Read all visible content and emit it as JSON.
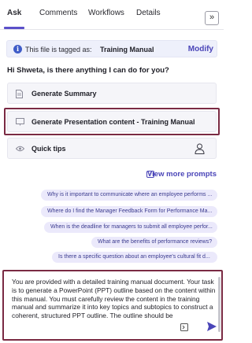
{
  "tabs": [
    {
      "label": "Ask",
      "active": true
    },
    {
      "label": "Comments",
      "active": false
    },
    {
      "label": "Workflows",
      "active": false
    },
    {
      "label": "Details",
      "active": false
    }
  ],
  "collapse_icon": "double-chevron-right",
  "banner": {
    "icon": "info-icon",
    "text": "This file is tagged as:",
    "tag": "Training Manual",
    "action": "Modify"
  },
  "greeting": "Hi Shweta, is there anything I can do for you?",
  "actions": [
    {
      "label": "Generate Summary",
      "icon": "document-icon"
    },
    {
      "label": "Generate Presentation content - Training Manual",
      "icon": "presentation-icon"
    },
    {
      "label": "Quick tips",
      "icon": "eye-icon",
      "trailing_icon": "person-icon"
    }
  ],
  "more_prompts": "View more prompts",
  "suggestions": [
    "Why is it important to communicate where an employee performs ...",
    "Where do I find the Manager Feedback Form for Performance Ma...",
    "When is the deadline for managers to submit all employee perfor...",
    "What are the benefits of performance reviews?",
    "Is there a specific question about an employee's cultural fit d..."
  ],
  "input": {
    "value": "You are provided with a detailed training manual document. Your task is to generate a PowerPoint (PPT) outline based on the content within this manual. You must carefully review the content in the training manual and summarize it into key topics and subtopics to construct a coherent, structured PPT outline. The outline should be"
  },
  "colors": {
    "accent": "#4a45b8",
    "highlight_border": "#7a2a43",
    "chip_bg": "#ebe9fb",
    "banner_bg": "#eef0fb"
  }
}
